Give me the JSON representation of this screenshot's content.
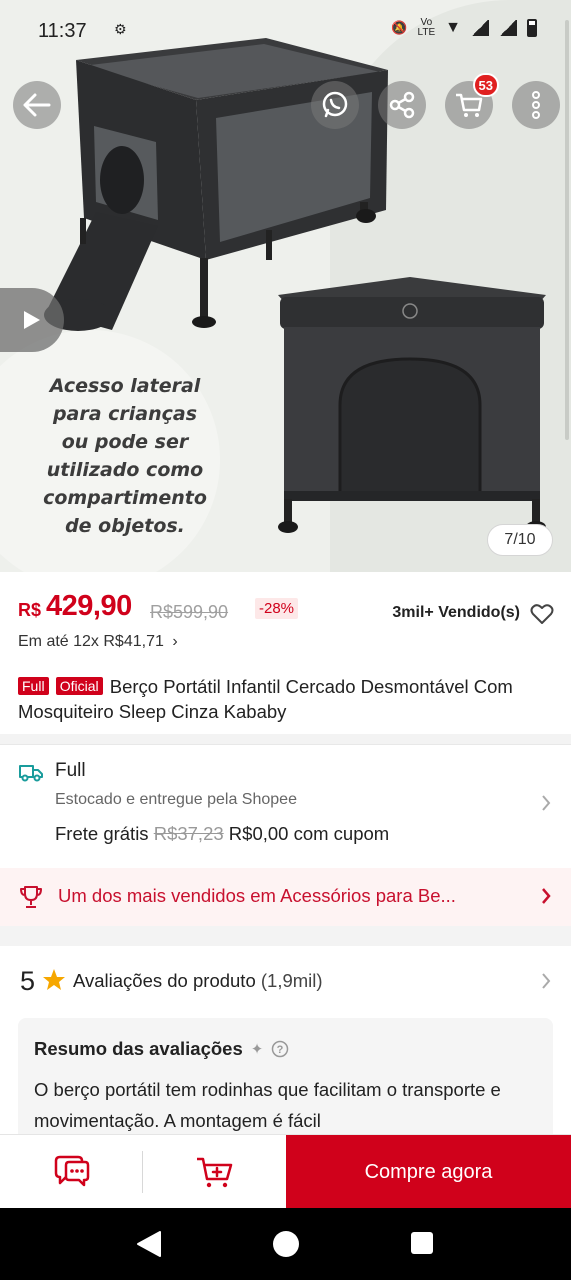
{
  "status_bar": {
    "time": "11:37",
    "network": "LTE"
  },
  "gallery": {
    "caption_lines": [
      "Acesso lateral",
      "para crianças",
      "ou pode ser",
      "utilizado como",
      "compartimento",
      "de objetos."
    ],
    "counter": "7/10",
    "cart_count": "53"
  },
  "price": {
    "currency": "R$",
    "current": "429,90",
    "original": "R$599,90",
    "discount": "-28%",
    "sold": "3mil+ Vendido(s)",
    "installments": "Em até 12x R$41,71"
  },
  "product": {
    "tag_full": "Full",
    "tag_oficial": "Oficial",
    "title": "Berço Portátil Infantil Cercado Desmontável Com Mosquiteiro Sleep Cinza Kababy"
  },
  "shipping": {
    "label": "Full",
    "stock_text": "Estocado e entregue pela Shopee",
    "frete_label": "Frete grátis",
    "frete_old": "R$37,23",
    "frete_new": "R$0,00 com cupom"
  },
  "best_seller": {
    "text": "Um dos mais vendidos em Acessórios para Be..."
  },
  "reviews": {
    "score": "5",
    "label": "Avaliações do produto",
    "count": "(1,9mil)",
    "summary_title": "Resumo das avaliações",
    "summary_text": "O berço portátil tem rodinhas que facilitam o transporte e movimentação. A montagem é fácil"
  },
  "bottom_bar": {
    "buy_label": "Compre agora"
  },
  "colors": {
    "brand_red": "#d0011b",
    "best_seller_bg": "#fef3f3",
    "best_seller_text": "#c8102e"
  }
}
